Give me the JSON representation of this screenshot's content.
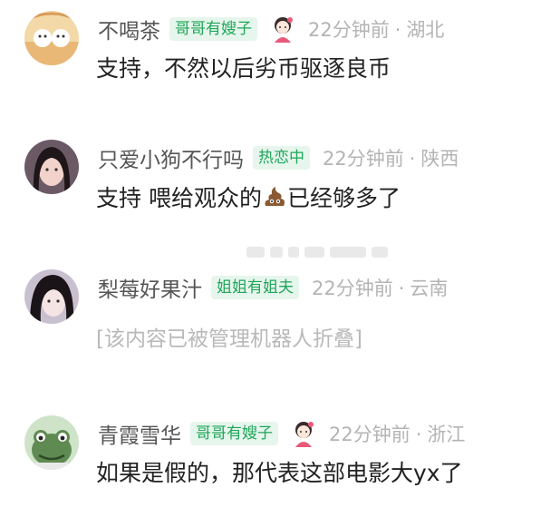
{
  "comments": [
    {
      "username": "不喝茶",
      "badge": "哥哥有嫂子",
      "has_decor": true,
      "time": "22分钟前",
      "location": "湖北",
      "text": "支持，不然以后劣币驱逐良币"
    },
    {
      "username": "只爱小狗不行吗",
      "badge": "热恋中",
      "has_decor": false,
      "time": "22分钟前",
      "location": "陕西",
      "text_before_emoji": "支持 喂给观众的",
      "emoji_icon": "poop-icon",
      "text_after_emoji": "已经够多了"
    },
    {
      "username": "梨莓好果汁",
      "badge": "姐姐有姐夫",
      "has_decor": false,
      "time": "22分钟前",
      "location": "云南",
      "text": "[该内容已被管理机器人折叠]"
    },
    {
      "username": "青霞雪华",
      "badge": "哥哥有嫂子",
      "has_decor": true,
      "time": "22分钟前",
      "location": "浙江",
      "text": "如果是假的，那代表这部电影大yx了"
    }
  ],
  "meta_separator": "·",
  "colors": {
    "badge_text": "#1fa65a",
    "badge_bg": "#e6f6ec",
    "username": "#555555",
    "meta": "#b4b4b4",
    "folded_text": "#b9b9b9"
  }
}
